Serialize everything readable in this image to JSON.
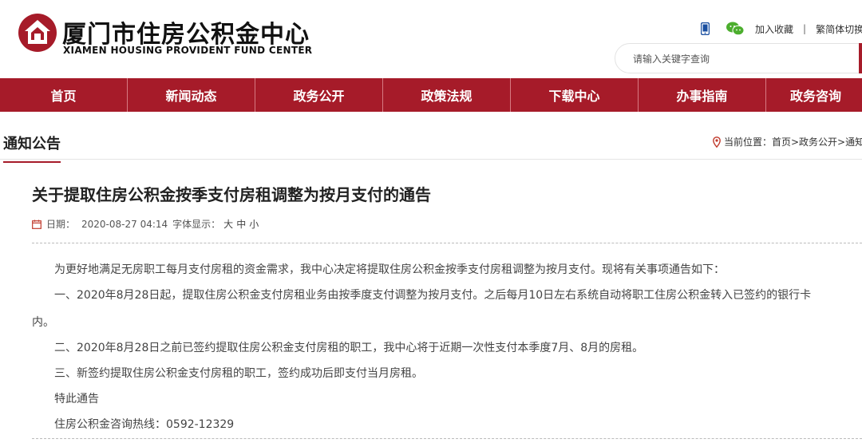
{
  "header": {
    "title_cn": "厦门市住房公积金中心",
    "title_en": "XIAMEN HOUSING PROVIDENT FUND CENTER",
    "brand_color": "#a61b29"
  },
  "top_links": {
    "phone_icon": "phone-icon",
    "wechat_icon": "wechat-icon",
    "favorite": "加入收藏",
    "separator": "|",
    "lang_switch": "繁简体切换"
  },
  "search": {
    "placeholder": "请输入关键字查询"
  },
  "nav": {
    "items": [
      {
        "label": "首页"
      },
      {
        "label": "新闻动态"
      },
      {
        "label": "政务公开"
      },
      {
        "label": "政策法规"
      },
      {
        "label": "下载中心"
      },
      {
        "label": "办事指南"
      },
      {
        "label": "政务咨询"
      }
    ]
  },
  "section": {
    "title": "通知公告",
    "location": "当前位置：首页>政务公开>通知"
  },
  "article": {
    "title": "关于提取住房公积金按季支付房租调整为按月支付的通告",
    "date_label": "日期：",
    "date": "2020-08-27 04:14",
    "font_label": "字体显示：",
    "font_large": "大",
    "font_medium": "中",
    "font_small": "小",
    "paragraphs": {
      "intro": "为更好地满足无房职工每月支付房租的资金需求，我中心决定将提取住房公积金按季支付房租调整为按月支付。现将有关事项通告如下：",
      "item1_line1": "一、2020年8月28日起，提取住房公积金支付房租业务由按季度支付调整为按月支付。之后每月10日左右系统自动将职工住房公积金转入已签约的银行卡",
      "item1_line2": "内。",
      "item2": "二、2020年8月28日之前已签约提取住房公积金支付房租的职工，我中心将于近期一次性支付本季度7月、8月的房租。",
      "item3": "三、新签约提取住房公积金支付房租的职工，签约成功后即支付当月房租。",
      "closing": "特此通告",
      "hotline": "住房公积金咨询热线：0592-12329"
    }
  }
}
